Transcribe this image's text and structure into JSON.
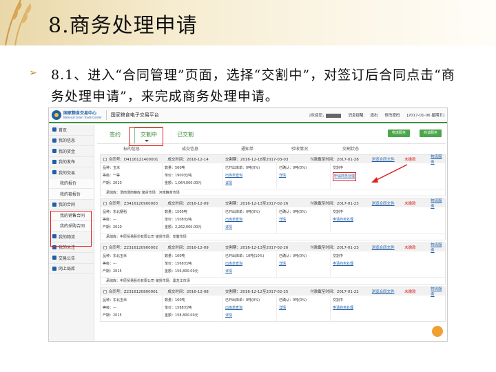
{
  "slide": {
    "title": "8.商务处理申请",
    "bullet": "➢",
    "desc": "8.1、进入“合同管理”页面，选择“交割中”，对签订后合同点击“商务处理申请”，来完成商务处理申请。"
  },
  "app": {
    "logo_cn": "国家粮食交易中心",
    "logo_en": "National Grain Trade Center",
    "system": "国家粮食电子交易平台",
    "welcome": "[欢迎您，",
    "msg": "消息提醒",
    "logout": "退出",
    "pwd": "修改密码",
    "date": "[2017-01-06 星期五]"
  },
  "nav": [
    {
      "label": "首页",
      "sub": false
    },
    {
      "label": "我的信息",
      "sub": false
    },
    {
      "label": "我的资金",
      "sub": false
    },
    {
      "label": "我的发布",
      "sub": false
    },
    {
      "label": "我的交易",
      "sub": false
    },
    {
      "label": "我的报价",
      "sub": true
    },
    {
      "label": "我的被报价",
      "sub": true
    },
    {
      "label": "我的合同",
      "sub": false
    },
    {
      "label": "我的销售合同",
      "sub": true
    },
    {
      "label": "我的采购合同",
      "sub": true
    },
    {
      "label": "我的物流",
      "sub": false
    },
    {
      "label": "我的关注",
      "sub": false
    },
    {
      "label": "交易公告",
      "sub": false
    },
    {
      "label": "网上局库",
      "sub": false
    }
  ],
  "tabs": [
    "签约",
    "交割中",
    "已交割"
  ],
  "buttons": [
    "物流服务",
    "商谈服务"
  ],
  "columns": [
    "标的信息",
    "成交信息",
    "通知单",
    "验收情况",
    "交割状态"
  ],
  "orders": [
    {
      "contract": "合同号：D4116121400001",
      "deal_time": "成交时间：2016-12-14",
      "period": "交割期：2016-12-18至2017-03-03",
      "deadline": "付款截至时间：2017-01-28",
      "r1": [
        "品种：玉米",
        "数量：560吨",
        "已开出库单：0吨(0%)",
        "已确认：0吨(0%)",
        "交割中"
      ],
      "r2": [
        "等级：一等",
        "单价：1900元/吨",
        "出库单查询",
        "详情",
        "申请商务处理"
      ],
      "r3": [
        "产期：2010",
        "金额：1,064,000.00元",
        "详情",
        "",
        ""
      ],
      "foot": "承储库：渭南渭南粮库   储货市场：河南粮食市场"
    },
    {
      "contract": "合同号：Z3416120900003",
      "deal_time": "成交时间：2016-12-09",
      "period": "交割期：2016-12-13至2017-02-26",
      "deadline": "付款截至时间：2017-01-23",
      "r1": [
        "品种：东北粳稻",
        "数量：1500吨",
        "已开出库单：0吨(0%)",
        "已确认：0吨(0%)",
        "交割中"
      ],
      "r2": [
        "等级：---",
        "单价：1508元/吨",
        "出库单查询",
        "详情",
        "申请商务处理"
      ],
      "r3": [
        "产期：2010",
        "金额：2,262,000.00元",
        "详情",
        "",
        ""
      ],
      "foot": "承储库：中原贸易股份有限公司   储货市场：安徽市场"
    },
    {
      "contract": "合同号：Z2316120900002",
      "deal_time": "成交时间：2016-12-09",
      "period": "交割期：2016-12-13至2017-02-26",
      "deadline": "付款截至时间：2017-01-23",
      "r1": [
        "品种：东北玉米",
        "数量：100吨",
        "已开出库单：10吨(10%)",
        "已确认：0吨(0%)",
        "交割中"
      ],
      "r2": [
        "等级：---",
        "单价：1568元/吨",
        "出库单查询",
        "详情",
        "申请商务处理"
      ],
      "r3": [
        "产期：2015",
        "金额：156,800.00元",
        "详情",
        "",
        ""
      ],
      "foot": "承储库：中原贸易股份有限公司   储货市场：黑龙江市场"
    },
    {
      "contract": "合同号：Z2316120800001",
      "deal_time": "成交时间：2016-12-08",
      "period": "交割期：2016-12-12至2017-02-25",
      "deadline": "付款截至时间：2017-01-22",
      "r1": [
        "品种：东北玉米",
        "数量：100吨",
        "已开出库单：0吨(0%)",
        "已确认：0吨(0%)",
        "交割中"
      ],
      "r2": [
        "等级：---",
        "单价：1588元/吨",
        "出库单查询",
        "详情",
        "申请商务处理"
      ],
      "r3": [
        "产期：2015",
        "金额：158,800.00元",
        "详情",
        "",
        ""
      ],
      "foot": ""
    }
  ],
  "links": {
    "contract_file": "浏览合同文件",
    "unpaid": "未缴款",
    "logistics": "物流服务"
  }
}
